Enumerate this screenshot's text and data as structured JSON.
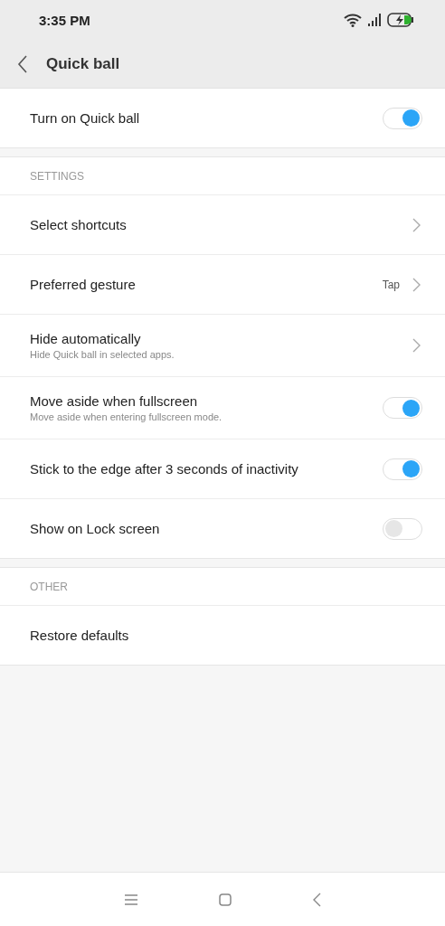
{
  "status_bar": {
    "time": "3:35 PM"
  },
  "header": {
    "title": "Quick ball"
  },
  "sections": [
    {
      "items": [
        {
          "kind": "toggle",
          "label": "Turn on Quick ball",
          "on": true
        }
      ]
    },
    {
      "title": "SETTINGS",
      "items": [
        {
          "kind": "chevron",
          "label": "Select shortcuts"
        },
        {
          "kind": "chevron",
          "label": "Preferred gesture",
          "value": "Tap"
        },
        {
          "kind": "chevron",
          "label": "Hide automatically",
          "subtitle": "Hide Quick ball in selected apps."
        },
        {
          "kind": "toggle",
          "label": "Move aside when fullscreen",
          "subtitle": "Move aside when entering fullscreen mode.",
          "on": true
        },
        {
          "kind": "toggle",
          "label": "Stick to the edge after 3 seconds of inactivity",
          "on": true
        },
        {
          "kind": "toggle",
          "label": "Show on Lock screen",
          "on": false
        }
      ]
    },
    {
      "title": "OTHER",
      "items": [
        {
          "kind": "plain",
          "label": "Restore defaults"
        }
      ]
    }
  ]
}
